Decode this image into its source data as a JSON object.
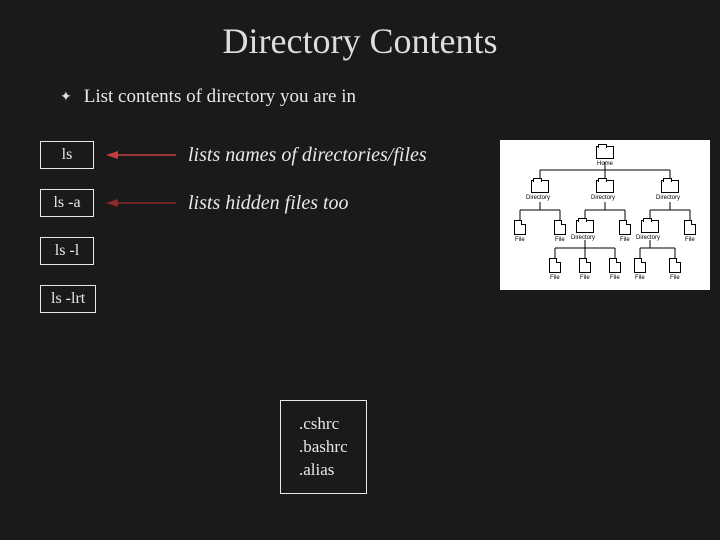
{
  "title": "Directory Contents",
  "bullet": "List contents of directory you are in",
  "commands": [
    {
      "cmd": "ls",
      "desc": "lists names of directories/files",
      "arrowColor": "#c04040"
    },
    {
      "cmd": "ls -a",
      "desc": "lists hidden files too",
      "arrowColor": "#8b2a2a"
    },
    {
      "cmd": "ls -l",
      "desc": ""
    },
    {
      "cmd": "ls -lrt",
      "desc": ""
    }
  ],
  "hiddenFiles": [
    ".cshrc",
    ".bashrc",
    ".alias"
  ],
  "diagram": {
    "root": "Home",
    "level1": [
      "Directory",
      "Directory",
      "Directory"
    ],
    "level2": [
      "File",
      "File",
      "Directory",
      "File",
      "Directory",
      "File"
    ],
    "level3": [
      "File",
      "File",
      "File",
      "File",
      "File"
    ]
  }
}
